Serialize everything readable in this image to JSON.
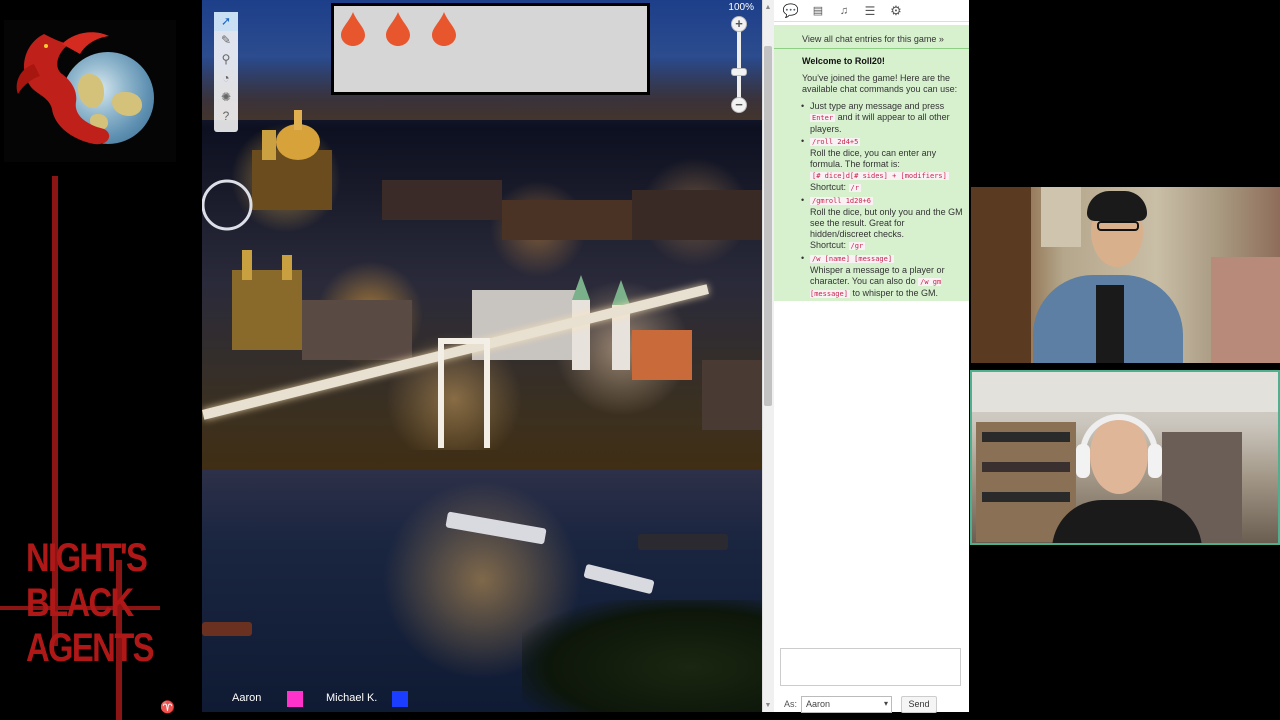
{
  "branding": {
    "title_lines": [
      "NIGHT'S",
      "BLACK",
      "AGENTS"
    ],
    "logo_icon": "dragon-globe-logo",
    "mark_icon": "publisher-mark-icon"
  },
  "map": {
    "zoom": "100%",
    "tools": [
      "select-icon",
      "draw-icon",
      "zoom-icon",
      "measure-icon",
      "fog-icon",
      "help-icon"
    ],
    "tracker_tokens": 3,
    "colors": {
      "tracker_bg": "#d6d6d6",
      "blood_drop": "#e8562e"
    },
    "players": [
      {
        "name": "Aaron",
        "color": "#ff33cc"
      },
      {
        "name": "Michael K.",
        "color": "#1a3dff"
      }
    ]
  },
  "sidebar": {
    "tabs": [
      "chat-icon",
      "journal-icon",
      "compendium-icon",
      "list-icon",
      "settings-icon"
    ],
    "chat": {
      "view_all": "View all chat entries for this game »",
      "welcome_title": "Welcome to Roll20!",
      "intro": "You've joined the game! Here are the available chat commands you can use:",
      "cmd1_pre": "Just type any message and press",
      "cmd1_code": "Enter",
      "cmd1_post": "and it will appear to all other players.",
      "cmd2_code": "/roll 2d4+5",
      "cmd2_text": "Roll the dice, you can enter any formula. The format is:",
      "cmd2_format": "[# dice]d[# sides] + [modifiers]",
      "cmd2_shortcut": "Shortcut:",
      "cmd2_shortcut_code": "/r",
      "cmd3_code": "/gmroll 1d20+6",
      "cmd3_text": "Roll the dice, but only you and the GM see the result. Great for hidden/discreet checks.",
      "cmd3_shortcut": "Shortcut:",
      "cmd3_shortcut_code": "/gr",
      "cmd4_code": "/w [name] [message]",
      "cmd4_text": "Whisper a message to a player or character. You can also do",
      "cmd4_code2": "/w gm [message]",
      "cmd4_post": "to whisper to the GM."
    },
    "as_label": "As:",
    "as_value": "Aaron",
    "send_label": "Send",
    "colors": {
      "chat_bg": "#d7f1cf",
      "code": "#c7254e"
    }
  },
  "webcams": {
    "count": 2,
    "active_border": "#4fb08f"
  }
}
